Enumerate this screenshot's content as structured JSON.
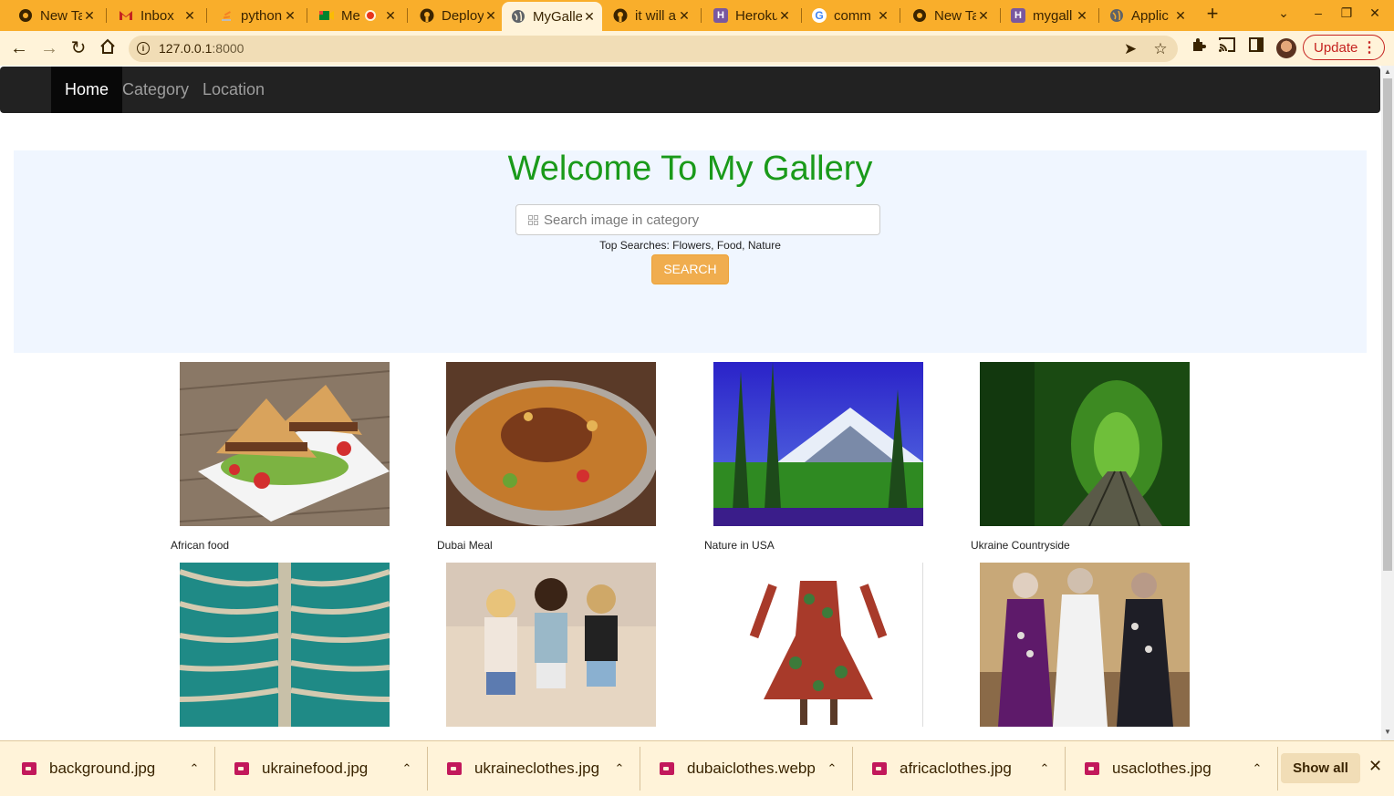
{
  "browser": {
    "tabs": [
      {
        "title": "New Tab",
        "icon": "chrome-icon"
      },
      {
        "title": "Inbox",
        "icon": "gmail-icon"
      },
      {
        "title": "python",
        "icon": "stackoverflow-icon"
      },
      {
        "title": "Me",
        "icon": "meet-icon"
      },
      {
        "title": "Deploy",
        "icon": "github-icon"
      },
      {
        "title": "MyGallery",
        "icon": "globe-icon"
      },
      {
        "title": "it will a",
        "icon": "github-icon"
      },
      {
        "title": "Heroku",
        "icon": "heroku-icon"
      },
      {
        "title": "comm",
        "icon": "google-icon"
      },
      {
        "title": "New Tab",
        "icon": "chrome-icon"
      },
      {
        "title": "mygall",
        "icon": "heroku-icon"
      },
      {
        "title": "Applic",
        "icon": "globe-icon"
      }
    ],
    "active_tab_index": 5,
    "url_host": "127.0.0.1",
    "url_port": ":8000",
    "update_label": "Update"
  },
  "site": {
    "nav": {
      "home": "Home",
      "category": "Category",
      "location": "Location"
    },
    "hero": {
      "title": "Welcome To My Gallery",
      "search_placeholder": "Search image in category",
      "top_searches": "Top Searches: Flowers, Food, Nature",
      "search_button": "SEARCH"
    },
    "gallery": [
      {
        "caption": "African food"
      },
      {
        "caption": "Dubai Meal"
      },
      {
        "caption": "Nature in USA"
      },
      {
        "caption": "Ukraine Countryside"
      },
      {
        "caption": ""
      },
      {
        "caption": ""
      },
      {
        "caption": ""
      },
      {
        "caption": ""
      }
    ]
  },
  "downloads": {
    "items": [
      "background.jpg",
      "ukrainefood.jpg",
      "ukraineclothes.jpg",
      "dubaiclothes.webp",
      "africaclothes.jpg",
      "usaclothes.jpg"
    ],
    "show_all": "Show all"
  },
  "colors": {
    "tab_strip": "#f9ae2b",
    "toolbar": "#fff3d9",
    "navbar": "#222222",
    "hero_bg": "#f0f6ff",
    "title_green": "#1a9a1a",
    "search_button": "#f0ad4e"
  }
}
